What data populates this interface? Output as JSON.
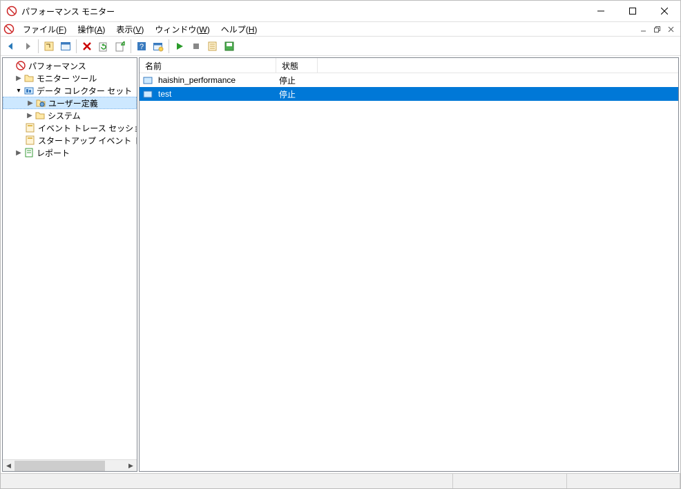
{
  "window": {
    "title": "パフォーマンス モニター"
  },
  "menus": {
    "file": "ファイル(F)",
    "action": "操作(A)",
    "view": "表示(V)",
    "window": "ウィンドウ(W)",
    "help": "ヘルプ(H)"
  },
  "tree": {
    "root": "パフォーマンス",
    "monitor_tools": "モニター ツール",
    "data_collector_sets": "データ コレクター セット",
    "user_defined": "ユーザー定義",
    "system": "システム",
    "event_trace": "イベント トレース セッション",
    "startup_event": "スタートアップ イベント トレース",
    "reports": "レポート"
  },
  "list": {
    "columns": {
      "name": "名前",
      "status": "状態"
    },
    "rows": [
      {
        "name": "haishin_performance",
        "status": "停止",
        "selected": false
      },
      {
        "name": "test",
        "status": "停止",
        "selected": true
      }
    ]
  }
}
